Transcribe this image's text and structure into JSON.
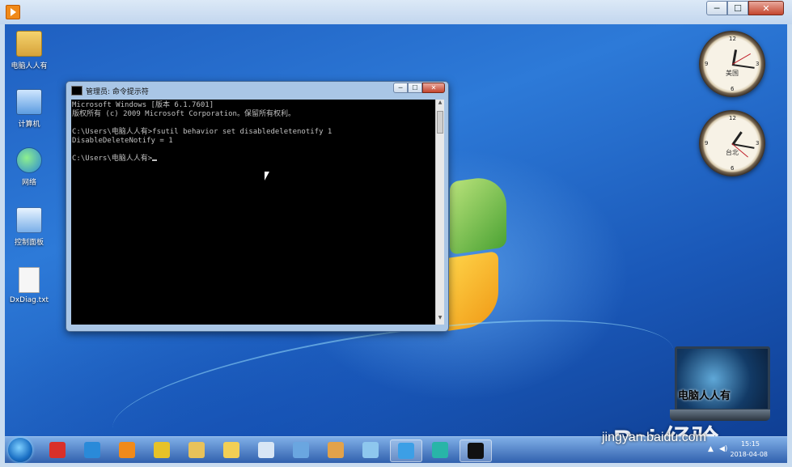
{
  "window": {
    "min": "─",
    "max": "☐",
    "close": "✕"
  },
  "desktop_icons": [
    {
      "label": "电脑人人有",
      "icon": "folder-icon"
    },
    {
      "label": "计算机",
      "icon": "computer-icon"
    },
    {
      "label": "网络",
      "icon": "network-icon"
    },
    {
      "label": "控制面板",
      "icon": "control-panel-icon"
    },
    {
      "label": "DxDiag.txt",
      "icon": "text-file-icon"
    }
  ],
  "clocks": [
    {
      "city": "美国",
      "n12": "12",
      "n3": "3",
      "n6": "6",
      "n9": "9"
    },
    {
      "city": "台北",
      "n12": "12",
      "n3": "3",
      "n6": "6",
      "n9": "9"
    }
  ],
  "cmd": {
    "title": "管理员: 命令提示符",
    "lines": [
      "Microsoft Windows [版本 6.1.7601]",
      "版权所有 (c) 2009 Microsoft Corporation。保留所有权利。",
      "",
      "C:\\Users\\电脑人人有>fsutil behavior set disabledeletenotify 1",
      "DisableDeleteNotify = 1",
      "",
      "C:\\Users\\电脑人人有>"
    ]
  },
  "gadget": {
    "text": "电脑人人有"
  },
  "taskbar": {
    "time": "15:15",
    "date": "2018-04-08",
    "items": [
      {
        "icon": "jiang-app-icon",
        "color": "#d9302a",
        "active": false
      },
      {
        "icon": "ie-browser-icon",
        "color": "#2a8ad9",
        "active": false
      },
      {
        "icon": "media-player-icon",
        "color": "#f08a1a",
        "active": false
      },
      {
        "icon": "chrome-icon",
        "color": "#e6c228",
        "active": false
      },
      {
        "icon": "file-explorer-icon",
        "color": "#e8c25a",
        "active": false
      },
      {
        "icon": "folder-icon",
        "color": "#f2cf55",
        "active": false
      },
      {
        "icon": "document-icon",
        "color": "#d8e6f5",
        "active": false
      },
      {
        "icon": "network-app-icon",
        "color": "#6aa6e0",
        "active": false
      },
      {
        "icon": "paint-icon",
        "color": "#e2a24a",
        "active": false
      },
      {
        "icon": "settings-gear-icon",
        "color": "#8ec7ee",
        "active": false
      },
      {
        "icon": "browser-app-icon",
        "color": "#3c9fe6",
        "active": true
      },
      {
        "icon": "headset-app-icon",
        "color": "#28b5a8",
        "active": false
      },
      {
        "icon": "cmd-icon",
        "color": "#111111",
        "active": true
      }
    ]
  },
  "watermark": {
    "brand": "Bai 经验",
    "url": "jingyan.baidu.com"
  }
}
